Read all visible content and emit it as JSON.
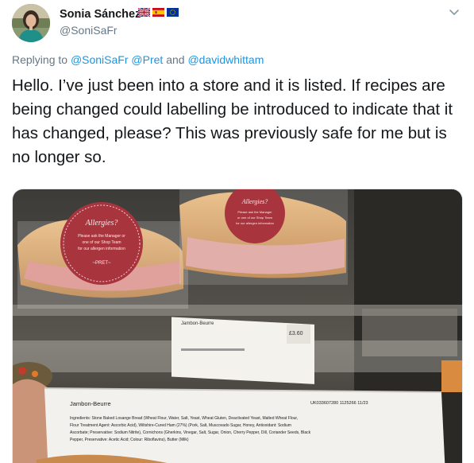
{
  "tweet": {
    "author": {
      "display_name": "Sonia Sánchez",
      "handle": "@SoniSaFr",
      "flags": [
        "uk-flag-icon",
        "spain-flag-icon",
        "eu-flag-icon"
      ]
    },
    "replying": {
      "prefix": "Replying to",
      "mention_1": "@SoniSaFr",
      "mention_2": "@Pret",
      "conjunction": "and",
      "mention_3": "@davidwhittam"
    },
    "text": "Hello. I’ve just been into a store and it is listed. If recipes are being changed could labelling be introduced to indicate that it has changed, please? This was previously safe for me but is no longer so.",
    "media": {
      "sandwich_tag_1": [
        "Allergies?",
        "Please ask the Manager or",
        "one of our Shop Team",
        "for our allergen information",
        "~PRET~"
      ],
      "sandwich_tag_2": [
        "Allergies?",
        "Please ask the Manager",
        "or one of our Shop Team",
        "for our allergen information"
      ],
      "shelf_label_name": "Jambon-Beurre",
      "shelf_price": "£3.60",
      "package_name": "Jambon-Beurre",
      "package_code": "UK033607280 1125266 11/23",
      "ingredients": [
        "Ingredients: Stone Baked Losange Bread (Wheat Flour, Water, Salt, Yeast, Wheat Gluten, Deactivated Yeast, Malted Wheat Flour,",
        "Flour Treatment Agent: Ascorbic Acid), Wiltshire-Cured Ham (27%) (Pork, Salt, Muscovado Sugar, Honey, Antioxidant: Sodium",
        "Ascorbate; Preservative: Sodium Nitrite), Cornichons (Gherkins, Vinegar, Salt, Sugar, Onion, Cherry Pepper, Dill, Coriander Seeds, Black",
        "Pepper, Preservative: Acetic Acid; Colour: Riboflavins), Butter (Milk)"
      ]
    }
  },
  "colors": {
    "link": "#1b95e0",
    "muted": "#657786",
    "text": "#14171a"
  }
}
